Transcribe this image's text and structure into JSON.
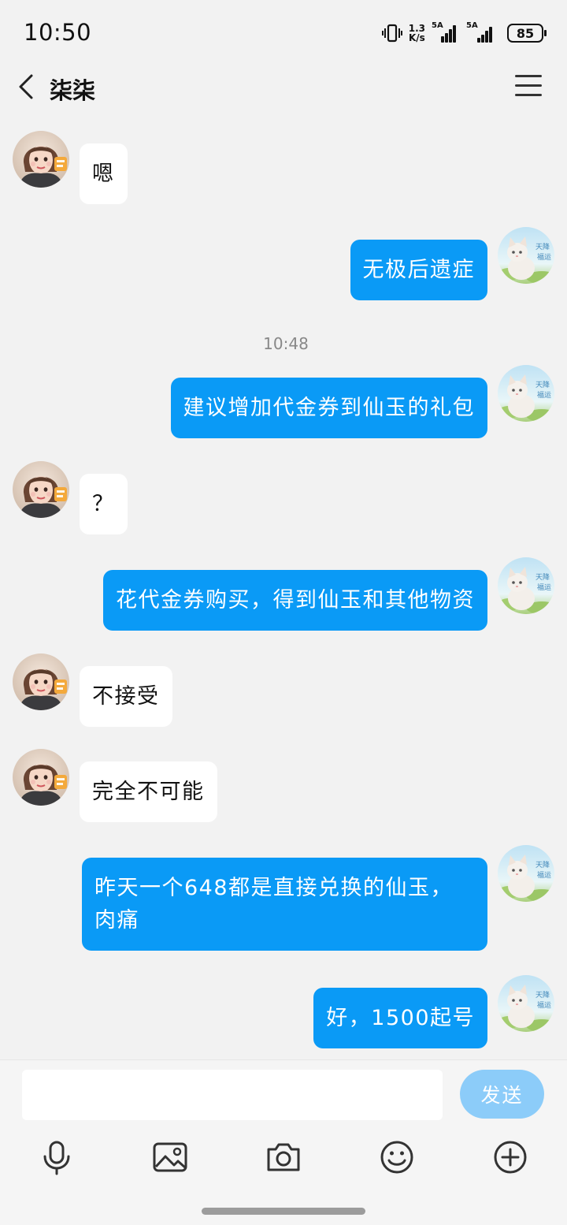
{
  "status_bar": {
    "time": "10:50",
    "net_speed_value": "1.3",
    "net_speed_unit": "K/s",
    "signal1_label": "5A",
    "signal2_label": "5A",
    "battery": "85"
  },
  "header": {
    "contact_name": "柒柒"
  },
  "messages": [
    {
      "side": "in",
      "text": "嗯"
    },
    {
      "side": "out",
      "text": "无极后遗症"
    },
    {
      "side": "out",
      "text": "建议增加代金券到仙玉的礼包"
    },
    {
      "side": "in",
      "text": "？"
    },
    {
      "side": "out",
      "text": "花代金券购买，得到仙玉和其他物资"
    },
    {
      "side": "in",
      "text": "不接受"
    },
    {
      "side": "in",
      "text": "完全不可能"
    },
    {
      "side": "out",
      "text": "昨天一个648都是直接兑换的仙玉，肉痛"
    },
    {
      "side": "out",
      "text": "好，1500起号"
    }
  ],
  "timestamp": "10:48",
  "composer": {
    "value": "",
    "send_label": "发送"
  },
  "toolbar": {
    "icons": [
      "microphone-icon",
      "image-icon",
      "camera-icon",
      "emoji-icon",
      "plus-icon"
    ]
  },
  "colors": {
    "outgoing_bubble": "#0a9af6",
    "incoming_bubble": "#ffffff",
    "background": "#f2f2f2",
    "send_button": "#8cccf9"
  }
}
